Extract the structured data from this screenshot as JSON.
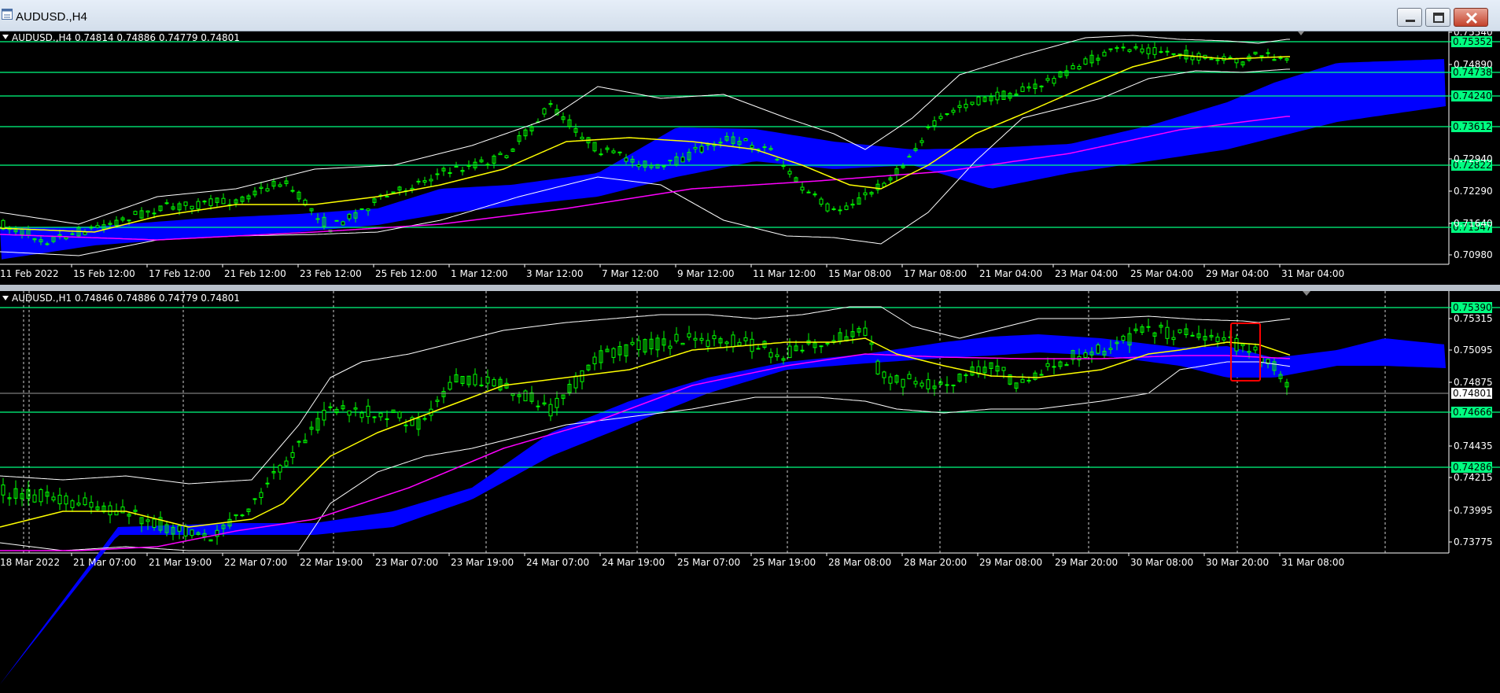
{
  "window": {
    "title": "AUDUSD.,H4",
    "buttons": [
      "minimize",
      "maximize",
      "close"
    ]
  },
  "colors": {
    "background": "#000000",
    "candle": "#00ff00",
    "ma_fast": "#ffff00",
    "ma_slow": "#ff00ff",
    "bands": "#ffffff",
    "cloud": "#0000ff",
    "hline": "#00ff80",
    "marker": "#ff0000"
  },
  "panes": [
    {
      "header": "AUDUSD.,H4  0.74814 0.74886 0.74779 0.74801",
      "price_ticks": [
        "0.75540",
        "0.74890",
        "0.72940",
        "0.72290",
        "0.71640",
        "0.70980"
      ],
      "hline_labels": [
        "0.75352",
        "0.74738",
        "0.74240",
        "0.73612",
        "0.72822",
        "0.71547"
      ],
      "time_ticks": [
        "11 Feb 2022",
        "15 Feb 12:00",
        "17 Feb 12:00",
        "21 Feb 12:00",
        "23 Feb 12:00",
        "25 Feb 12:00",
        "1 Mar 12:00",
        "3 Mar 12:00",
        "7 Mar 12:00",
        "9 Mar 12:00",
        "11 Mar 12:00",
        "15 Mar 08:00",
        "17 Mar 08:00",
        "21 Mar 04:00",
        "23 Mar 04:00",
        "25 Mar 04:00",
        "29 Mar 04:00",
        "31 Mar 04:00"
      ]
    },
    {
      "header": "AUDUSD.,H1  0.74846 0.74886 0.74779 0.74801",
      "price_ticks": [
        "0.75315",
        "0.75095",
        "0.74875",
        "0.74435",
        "0.74215",
        "0.73995",
        "0.73775"
      ],
      "hline_labels": [
        "0.75390",
        "0.74666",
        "0.74286"
      ],
      "current_price": "0.74801",
      "time_ticks": [
        "18 Mar 2022",
        "21 Mar 07:00",
        "21 Mar 19:00",
        "22 Mar 07:00",
        "22 Mar 19:00",
        "23 Mar 07:00",
        "23 Mar 19:00",
        "24 Mar 07:00",
        "24 Mar 19:00",
        "25 Mar 07:00",
        "25 Mar 19:00",
        "28 Mar 08:00",
        "28 Mar 20:00",
        "29 Mar 08:00",
        "29 Mar 20:00",
        "30 Mar 08:00",
        "30 Mar 20:00",
        "31 Mar 08:00"
      ]
    }
  ]
}
